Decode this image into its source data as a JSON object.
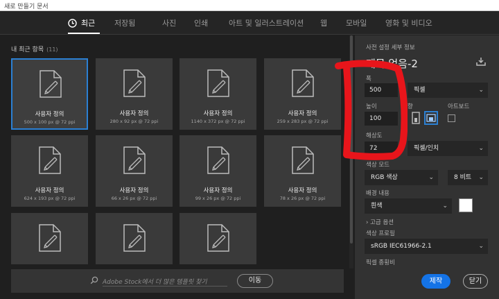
{
  "window": {
    "title": "새로 만들기 문서"
  },
  "tabs": [
    {
      "label": "최근",
      "active": true
    },
    {
      "label": "저장됨"
    },
    {
      "label": "사진"
    },
    {
      "label": "인쇄"
    },
    {
      "label": "아트 및 일러스트레이션"
    },
    {
      "label": "웹"
    },
    {
      "label": "모바일"
    },
    {
      "label": "영화 및 비디오"
    }
  ],
  "recent": {
    "label": "내 최근 항목",
    "count": "(11)",
    "items": [
      {
        "name": "사용자 정의",
        "dims": "500 x 100 px @ 72 ppi",
        "selected": true
      },
      {
        "name": "사용자 정의",
        "dims": "280 x 92 px @ 72 ppi"
      },
      {
        "name": "사용자 정의",
        "dims": "1140 x 372 px @ 72 ppi"
      },
      {
        "name": "사용자 정의",
        "dims": "259 x 283 px @ 72 ppi"
      },
      {
        "name": "사용자 정의",
        "dims": "624 x 193 px @ 72 ppi"
      },
      {
        "name": "사용자 정의",
        "dims": "66 x 26 px @ 72 ppi"
      },
      {
        "name": "사용자 정의",
        "dims": "99 x 26 px @ 72 ppi"
      },
      {
        "name": "사용자 정의",
        "dims": "78 x 26 px @ 72 ppi"
      },
      {
        "name": "",
        "dims": ""
      },
      {
        "name": "",
        "dims": ""
      },
      {
        "name": "",
        "dims": ""
      }
    ]
  },
  "stock": {
    "placeholder": "Adobe Stock에서 더 많은 템플릿 찾기",
    "go_label": "이동"
  },
  "preset": {
    "header": "사전 설정 세부 정보",
    "doc_name": "제목 없음-2",
    "width_label": "폭",
    "width_value": "500",
    "width_unit": "픽셀",
    "height_label": "높이",
    "height_value": "100",
    "orientation_label": "방향",
    "artboard_label": "아트보드",
    "resolution_label": "해상도",
    "resolution_value": "72",
    "resolution_unit": "픽셀/인치",
    "color_mode_label": "색상 모드",
    "color_mode_value": "RGB 색상",
    "bit_depth_value": "8 비트",
    "background_label": "배경 내용",
    "background_value": "흰색",
    "advanced_label": "고급 옵션",
    "color_profile_label": "색상 프로필",
    "color_profile_value": "sRGB IEC61966-2.1",
    "pixel_aspect_label": "픽셀 종횡비"
  },
  "actions": {
    "create": "제작",
    "close": "닫기"
  },
  "colors": {
    "accent": "#1473e6",
    "selection": "#2b80d4",
    "annotation": "#e8151b"
  }
}
